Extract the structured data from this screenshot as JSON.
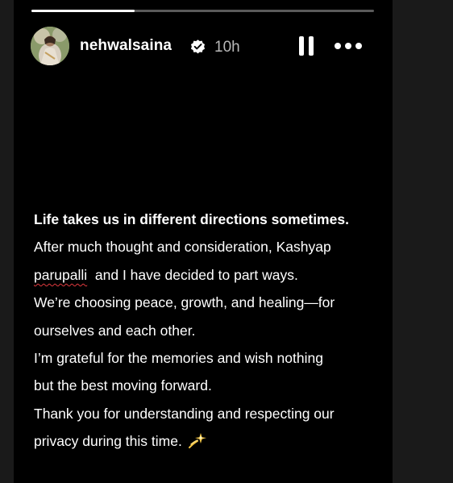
{
  "story": {
    "progress": 0.3,
    "user": {
      "username": "nehwalsaina",
      "verified": true,
      "timestamp": "10h",
      "avatar_icon": "profile-avatar"
    },
    "controls": {
      "pause_icon": "pause-icon",
      "more_icon": "more-horizontal-icon"
    },
    "caption": {
      "headline": "Life takes us in different directions sometimes.",
      "line_2": "After much thought and consideration, Kashyap",
      "line_3_misspelled": "parupalli",
      "line_3_rest": "  and I have decided to part ways.",
      "line_4": "We’re choosing peace, growth, and healing—for",
      "line_5": "ourselves and each other.",
      "line_6": "I’m grateful for the memories and wish nothing",
      "line_7": "but the best moving forward.",
      "line_8": "Thank you for understanding and respecting our",
      "line_9": "privacy during this time.",
      "emoji_icon": "dizzy-sparkle-icon"
    }
  },
  "colors": {
    "story_background": "#000000",
    "page_background": "#1a1a1a",
    "text": "#ffffff",
    "timestamp": "#b8b8b8",
    "progress_track": "#5a5a5a",
    "spellcheck_underline": "#e0393e"
  }
}
